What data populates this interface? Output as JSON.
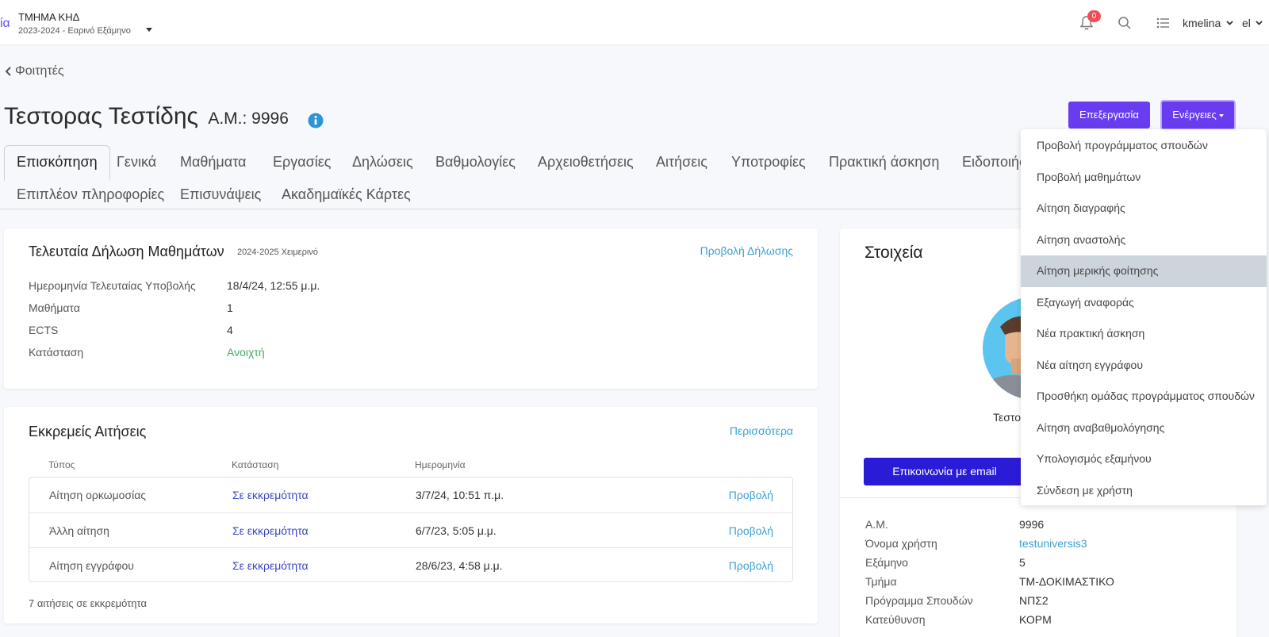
{
  "topbar": {
    "logo_fragment": "ία",
    "department": "ΤΜΗΜΑ ΚΗΔ",
    "term": "2023-2024 - Εαρινό Εξάμηνο",
    "notifications_count": "0",
    "username": "kmelina",
    "language": "el"
  },
  "back_link": "Φοιτητές",
  "student": {
    "name": "Τεστορας Τεστίδης",
    "am_label": "Α.Μ.: 9996"
  },
  "buttons": {
    "edit": "Επεξεργασία",
    "actions": "Ενέργειες"
  },
  "tabs": {
    "row1": [
      "Επισκόπηση",
      "Γενικά",
      "Μαθήματα",
      "Εργασίες",
      "Δηλώσεις",
      "Βαθμολογίες",
      "Αρχειοθετήσεις",
      "Αιτήσεις",
      "Υποτροφίες",
      "Πρακτική άσκηση",
      "Ειδοποιήσ"
    ],
    "row2": [
      "Επιπλέον πληροφορίες",
      "Επισυνάψεις",
      "Ακαδημαϊκές Κάρτες"
    ]
  },
  "last_declaration": {
    "title": "Τελευταία Δήλωση Μαθημάτων",
    "period": "2024-2025 Χειμερινό",
    "link": "Προβολή Δήλωσης",
    "fields": [
      {
        "label": "Ημερομηνία Τελευταίας Υποβολής",
        "value": "18/4/24, 12:55 μ.μ."
      },
      {
        "label": "Μαθήματα",
        "value": "1"
      },
      {
        "label": "ECTS",
        "value": "4"
      },
      {
        "label": "Κατάσταση",
        "value": "Ανοιχτή"
      }
    ]
  },
  "pending_requests": {
    "title": "Εκκρεμείς Αιτήσεις",
    "link": "Περισσότερα",
    "headers": [
      "Τύπος",
      "Κατάσταση",
      "Ημερομηνία"
    ],
    "rows": [
      {
        "type": "Αίτηση ορκωμοσίας",
        "status": "Σε εκκρεμότητα",
        "date": "3/7/24, 10:51 π.μ.",
        "action": "Προβολή"
      },
      {
        "type": "Άλλη αίτηση",
        "status": "Σε εκκρεμότητα",
        "date": "6/7/23, 5:05 μ.μ.",
        "action": "Προβολή"
      },
      {
        "type": "Αίτηση εγγράφου",
        "status": "Σε εκκρεμότητα",
        "date": "28/6/23, 4:58 μ.μ.",
        "action": "Προβολή"
      }
    ],
    "footer": "7 αιτήσεις σε εκκρεμότητα"
  },
  "details": {
    "title": "Στοιχεία",
    "name_fragment": "Τεστο",
    "email_button": "Επικοινωνία με email",
    "fields": [
      {
        "label": "Α.Μ.",
        "value": "9996"
      },
      {
        "label": "Όνομα χρήστη",
        "value": "testuniversis3"
      },
      {
        "label": "Εξάμηνο",
        "value": "5"
      },
      {
        "label": "Τμήμα",
        "value": "ΤΜ-ΔΟΚΙΜΑΣΤΙΚΟ"
      },
      {
        "label": "Πρόγραμμα Σπουδών",
        "value": "ΝΠΣ2"
      },
      {
        "label": "Κατεύθυνση",
        "value": "ΚΟΡΜ"
      }
    ]
  },
  "actions_menu": {
    "highlighted_index": 4,
    "items": [
      "Προβολή προγράμματος σπουδών",
      "Προβολή μαθημάτων",
      "Αίτηση διαγραφής",
      "Αίτηση αναστολής",
      "Αίτηση μερικής φοίτησης",
      "Εξαγωγή αναφοράς",
      "Νέα πρακτική άσκηση",
      "Νέα αίτηση εγγράφου",
      "Προσθήκη ομάδας προγράμματος σπουδών",
      "Αίτηση αναβαθμολόγησης",
      "Υπολογισμός εξαμήνου",
      "Σύνδεση με χρήστη"
    ]
  },
  "colors": {
    "primary": "#6a3cf0",
    "email_button": "#2a1bd6",
    "link": "#3aa0d8",
    "status_pending": "#3b46c4",
    "status_open": "#3fae63",
    "badge": "#f04e54"
  }
}
